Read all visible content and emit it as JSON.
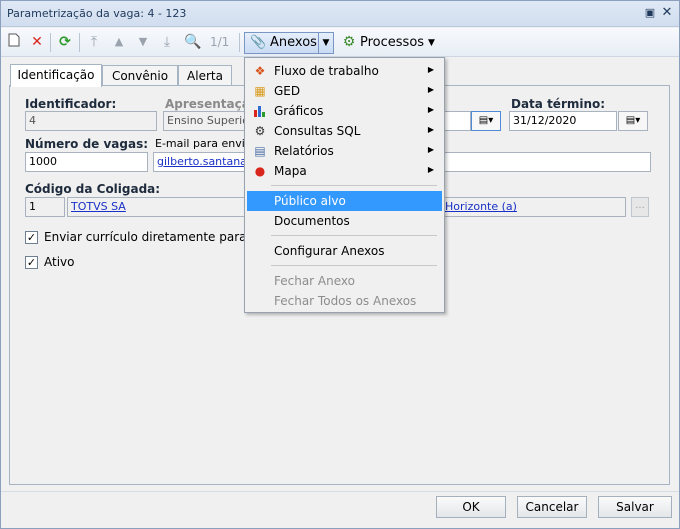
{
  "window": {
    "title": "Parametrização da vaga: 4 - 123"
  },
  "toolbar": {
    "record_counter": "1/1",
    "anexos_label": "Anexos",
    "processos_label": "Processos"
  },
  "tabs": [
    {
      "label": "Identificação"
    },
    {
      "label": "Convênio"
    },
    {
      "label": "Alerta"
    }
  ],
  "form": {
    "identificador_label": "Identificador:",
    "identificador_value": "4",
    "apresentacao_label": "Apresentação",
    "apresentacao_value": "Ensino Superior",
    "data_termino_label": "Data término:",
    "data_termino_value": "31/12/2020",
    "numero_vagas_label": "Número de vagas:",
    "numero_vagas_value": "1000",
    "email_label": "E-mail para envio d",
    "email_value": "gilberto.santana@t",
    "codigo_coligada_label": "Código da Coligada:",
    "codigo_coligada_value": "1",
    "coligada_name": "TOTVS SA",
    "coligada_extra": "Horizonte (a)",
    "ellipsis": "...",
    "enviar_curriculo_label": "Enviar currículo diretamente para empresa",
    "enviar_curriculo_checked": true,
    "ativo_label": "Ativo",
    "ativo_checked": true
  },
  "menu": {
    "items": [
      {
        "label": "Fluxo de trabalho",
        "icon": "workflow-icon",
        "submenu": true
      },
      {
        "label": "GED",
        "icon": "ged-icon",
        "submenu": true
      },
      {
        "label": "Gráficos",
        "icon": "bar-chart-icon",
        "submenu": true
      },
      {
        "label": "Consultas SQL",
        "icon": "sql-gear-icon",
        "submenu": true
      },
      {
        "label": "Relatórios",
        "icon": "report-icon",
        "submenu": true
      },
      {
        "label": "Mapa",
        "icon": "map-pin-icon",
        "submenu": true
      },
      {
        "label": "Público alvo",
        "highlighted": true
      },
      {
        "label": "Documentos"
      },
      {
        "label": "Configurar Anexos"
      },
      {
        "label": "Fechar Anexo",
        "disabled": true
      },
      {
        "label": "Fechar Todos os Anexos",
        "disabled": true
      }
    ]
  },
  "footer": {
    "ok_label": "OK",
    "cancel_label": "Cancelar",
    "save_label": "Salvar"
  },
  "colors": {
    "menu_highlight": "#3399ff",
    "link": "#1a31c7",
    "delete_red": "#d9261c",
    "refresh_green": "#2c9a2c"
  }
}
